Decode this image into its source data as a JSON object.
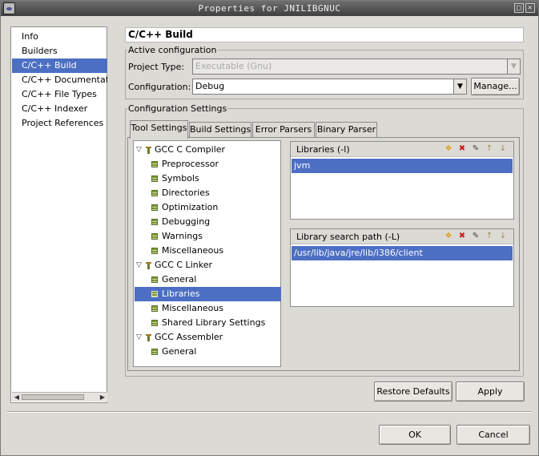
{
  "window": {
    "title": "Properties for JNILIBGNUC",
    "max_glyph": "□",
    "close_glyph": "✕"
  },
  "nav": {
    "items": [
      {
        "label": "Info",
        "selected": false
      },
      {
        "label": "Builders",
        "selected": false
      },
      {
        "label": "C/C++ Build",
        "selected": true
      },
      {
        "label": "C/C++ Documentation",
        "selected": false
      },
      {
        "label": "C/C++ File Types",
        "selected": false
      },
      {
        "label": "C/C++ Indexer",
        "selected": false
      },
      {
        "label": "Project References",
        "selected": false
      }
    ]
  },
  "page": {
    "title": "C/C++ Build",
    "active_config_label": "Active configuration",
    "project_type_label": "Project Type:",
    "project_type_value": "Executable (Gnu)",
    "configuration_label": "Configuration:",
    "configuration_value": "Debug",
    "manage_label": "Manage...",
    "config_settings_label": "Configuration Settings"
  },
  "tabs": [
    {
      "label": "Tool Settings",
      "active": true
    },
    {
      "label": "Build Settings",
      "active": false
    },
    {
      "label": "Error Parsers",
      "active": false
    },
    {
      "label": "Binary Parser",
      "active": false
    }
  ],
  "tree": [
    {
      "label": "GCC C Compiler",
      "type": "tool",
      "level": 0
    },
    {
      "label": "Preprocessor",
      "type": "option",
      "level": 1
    },
    {
      "label": "Symbols",
      "type": "option",
      "level": 1
    },
    {
      "label": "Directories",
      "type": "option",
      "level": 1
    },
    {
      "label": "Optimization",
      "type": "option",
      "level": 1
    },
    {
      "label": "Debugging",
      "type": "option",
      "level": 1
    },
    {
      "label": "Warnings",
      "type": "option",
      "level": 1
    },
    {
      "label": "Miscellaneous",
      "type": "option",
      "level": 1
    },
    {
      "label": "GCC C Linker",
      "type": "tool",
      "level": 0
    },
    {
      "label": "General",
      "type": "option",
      "level": 1
    },
    {
      "label": "Libraries",
      "type": "option",
      "level": 1,
      "selected": true
    },
    {
      "label": "Miscellaneous",
      "type": "option",
      "level": 1
    },
    {
      "label": "Shared Library Settings",
      "type": "option",
      "level": 1
    },
    {
      "label": "GCC Assembler",
      "type": "tool",
      "level": 0
    },
    {
      "label": "General",
      "type": "option",
      "level": 1
    }
  ],
  "libraries": {
    "header": "Libraries (-l)",
    "items": [
      "jvm"
    ]
  },
  "library_paths": {
    "header": "Library search path (-L)",
    "items": [
      "/usr/lib/java/jre/lib/i386/client"
    ]
  },
  "buttons": {
    "restore_defaults": "Restore Defaults",
    "apply": "Apply",
    "ok": "OK",
    "cancel": "Cancel"
  },
  "toolbar_icons": [
    "add-icon",
    "delete-icon",
    "edit-icon",
    "move-up-icon",
    "move-down-icon"
  ]
}
